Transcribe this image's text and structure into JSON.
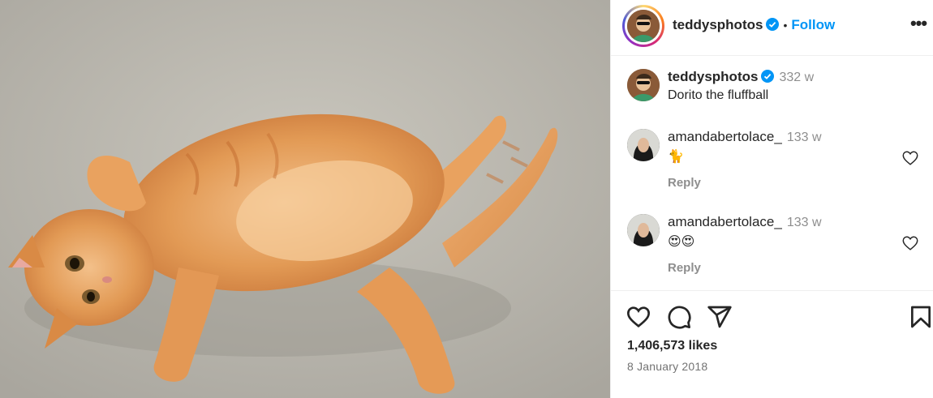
{
  "post": {
    "author": "teddysphotos",
    "header_separator": "•",
    "follow_label": "Follow",
    "more_label": "•••"
  },
  "caption": {
    "author": "teddysphotos",
    "time": "332 w",
    "text": "Dorito the fluffball"
  },
  "comments": [
    {
      "author": "amandabertolace_",
      "time": "133 w",
      "text": "🐈",
      "reply_label": "Reply"
    },
    {
      "author": "amandabertolace_",
      "time": "133 w",
      "text": "😍😍",
      "reply_label": "Reply"
    }
  ],
  "likes": "1,406,573 likes",
  "date": "8 January 2018",
  "colors": {
    "accent": "#0095f6",
    "muted": "#8e8e8e",
    "text": "#262626"
  },
  "icons": [
    "verified-badge-icon",
    "more-options-icon",
    "heart-icon",
    "comment-icon",
    "share-icon",
    "save-icon"
  ]
}
